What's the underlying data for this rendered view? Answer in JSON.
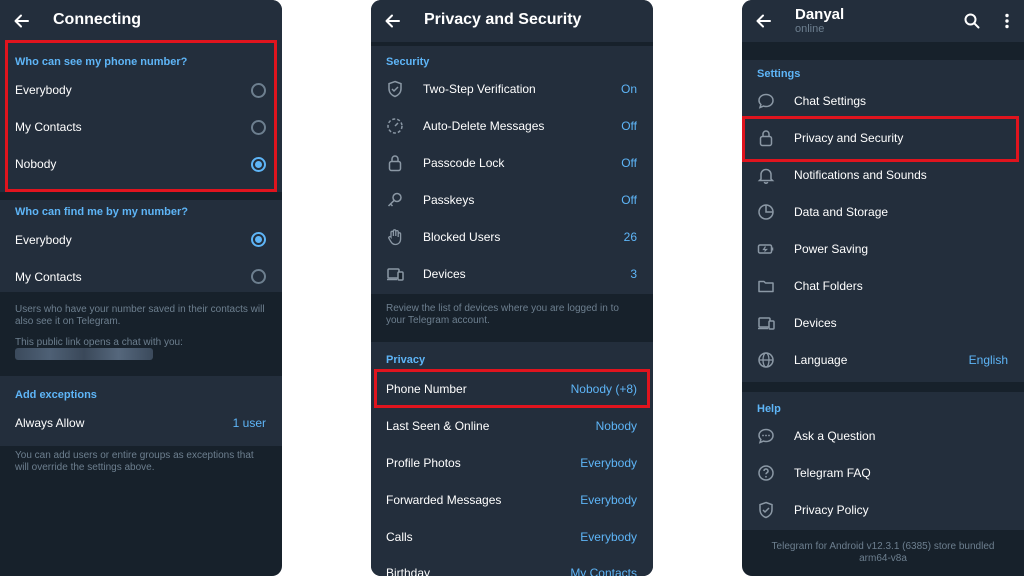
{
  "panel1": {
    "title": "Connecting",
    "section_phone_title": "Who can see my phone number?",
    "phone_options": [
      "Everybody",
      "My Contacts",
      "Nobody"
    ],
    "phone_selected": "Nobody",
    "section_find_title": "Who can find me by my number?",
    "find_options": [
      "Everybody",
      "My Contacts"
    ],
    "find_selected": "Everybody",
    "hint_saved": "Users who have your number saved in their contacts will also see it on Telegram.",
    "hint_link": "This public link opens a chat with you:",
    "exceptions_title": "Add exceptions",
    "always_allow_label": "Always Allow",
    "always_allow_value": "1 user",
    "hint_exceptions": "You can add users or entire groups as exceptions that will override the settings above."
  },
  "panel2": {
    "title": "Privacy and Security",
    "security_title": "Security",
    "security_items": [
      {
        "label": "Two-Step Verification",
        "value": "On",
        "icon": "shield-check-icon"
      },
      {
        "label": "Auto-Delete Messages",
        "value": "Off",
        "icon": "timer-icon"
      },
      {
        "label": "Passcode Lock",
        "value": "Off",
        "icon": "lock-icon"
      },
      {
        "label": "Passkeys",
        "value": "Off",
        "icon": "key-icon"
      },
      {
        "label": "Blocked Users",
        "value": "26",
        "icon": "hand-icon"
      },
      {
        "label": "Devices",
        "value": "3",
        "icon": "devices-icon"
      }
    ],
    "devices_hint": "Review the list of devices where you are logged in to your Telegram account.",
    "privacy_title": "Privacy",
    "privacy_items": [
      {
        "label": "Phone Number",
        "value": "Nobody (+8)"
      },
      {
        "label": "Last Seen & Online",
        "value": "Nobody"
      },
      {
        "label": "Profile Photos",
        "value": "Everybody"
      },
      {
        "label": "Forwarded Messages",
        "value": "Everybody"
      },
      {
        "label": "Calls",
        "value": "Everybody"
      },
      {
        "label": "Birthday",
        "value": "My Contacts"
      }
    ]
  },
  "panel3": {
    "user_name": "Danyal",
    "user_status": "online",
    "settings_title": "Settings",
    "settings_items": [
      {
        "label": "Chat Settings",
        "value": "",
        "icon": "chat-bubble-icon"
      },
      {
        "label": "Privacy and Security",
        "value": "",
        "icon": "lock-icon"
      },
      {
        "label": "Notifications and Sounds",
        "value": "",
        "icon": "bell-icon"
      },
      {
        "label": "Data and Storage",
        "value": "",
        "icon": "pie-chart-icon"
      },
      {
        "label": "Power Saving",
        "value": "",
        "icon": "battery-icon"
      },
      {
        "label": "Chat Folders",
        "value": "",
        "icon": "folder-icon"
      },
      {
        "label": "Devices",
        "value": "",
        "icon": "devices-icon"
      },
      {
        "label": "Language",
        "value": "English",
        "icon": "globe-icon"
      }
    ],
    "help_title": "Help",
    "help_items": [
      {
        "label": "Ask a Question",
        "icon": "chat-dots-icon"
      },
      {
        "label": "Telegram FAQ",
        "icon": "question-icon"
      },
      {
        "label": "Privacy Policy",
        "icon": "shield-check-icon"
      }
    ],
    "footer_line1": "Telegram for Android v12.3.1 (6385) store bundled",
    "footer_line2": "arm64-v8a"
  },
  "colors": {
    "background": "#17212b",
    "section_background": "#232e3c",
    "accent": "#5eb5f7",
    "secondary_text": "#6d7f8f",
    "highlight": "#e0141e"
  }
}
